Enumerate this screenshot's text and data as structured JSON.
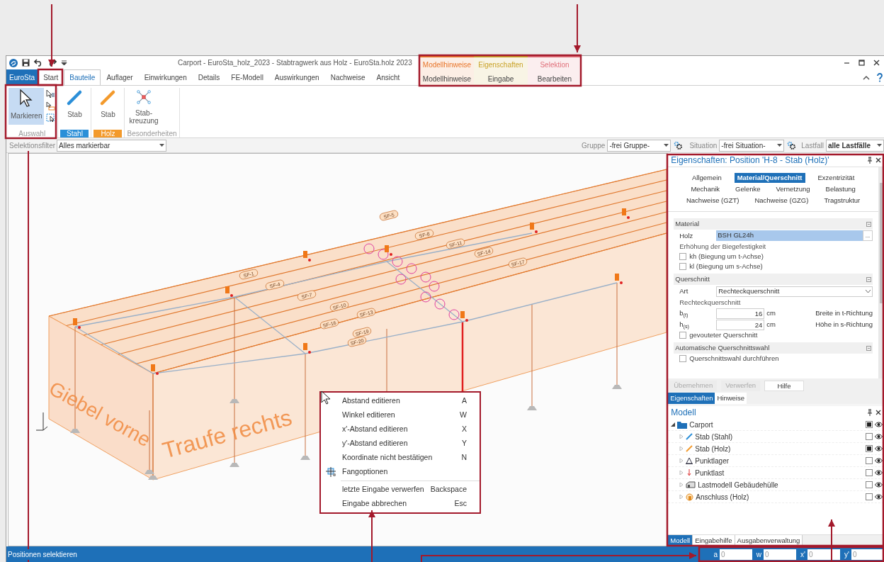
{
  "window": {
    "title": "Carport - EuroSta_holz_2023 - Stabtragwerk aus Holz - EuroSta.holz 2023"
  },
  "ribbon_tabs": [
    {
      "label": "EuroSta",
      "kind": "file",
      "selected": false
    },
    {
      "label": "Start",
      "kind": "tab",
      "selected": false
    },
    {
      "label": "Bauteile",
      "kind": "tab",
      "selected": true
    },
    {
      "label": "Auflager",
      "kind": "tab",
      "selected": false
    },
    {
      "label": "Einwirkungen",
      "kind": "tab",
      "selected": false
    },
    {
      "label": "Details",
      "kind": "tab",
      "selected": false
    },
    {
      "label": "FE-Modell",
      "kind": "tab",
      "selected": false
    },
    {
      "label": "Auswirkungen",
      "kind": "tab",
      "selected": false
    },
    {
      "label": "Nachweise",
      "kind": "tab",
      "selected": false
    },
    {
      "label": "Ansicht",
      "kind": "tab",
      "selected": false
    }
  ],
  "contextual_tabs": [
    {
      "group": "Modellhinweise",
      "label": "Modellhinweise",
      "color": "#e8752a"
    },
    {
      "group": "Eigenschaften",
      "label": "Eingabe",
      "color": "#c9a227"
    },
    {
      "group": "Selektion",
      "label": "Bearbeiten",
      "color": "#e0707a"
    }
  ],
  "ribbon_groups": [
    {
      "label": "Auswahl",
      "kind": "select",
      "buttons": [
        {
          "label": "Markieren",
          "selected": true
        }
      ]
    },
    {
      "label": "Stahl",
      "kind": "colored",
      "color": "#2b8fd8",
      "buttons": [
        {
          "label": "Stab",
          "selected": false
        }
      ]
    },
    {
      "label": "Holz",
      "kind": "colored",
      "color": "#f39a2c",
      "buttons": [
        {
          "label": "Stab",
          "selected": false
        }
      ]
    },
    {
      "label": "Besonderheiten",
      "kind": "plain",
      "buttons": [
        {
          "label": "Stab-\nkreuzung",
          "selected": false
        }
      ]
    }
  ],
  "filter_bar": {
    "selection_filter": {
      "label": "Selektionsfilter",
      "value": "Alles markierbar"
    },
    "group": {
      "label": "Gruppe",
      "value": "-frei Gruppe-"
    },
    "situation": {
      "label": "Situation",
      "value": "-frei Situation-"
    },
    "load_case": {
      "label": "Lastfall",
      "value": "alle Lastfälle"
    }
  },
  "viewport": {
    "gable_text": "Giebel vorne",
    "eaves_text": "Traufe rechts",
    "member_labels": [
      "SF-1",
      "SF-4",
      "SF-7",
      "SF-10",
      "SF-13",
      "SF-16",
      "SF-19",
      "SF-20",
      "SF-5",
      "SF-8",
      "SF-11",
      "SF-14",
      "SF-17"
    ]
  },
  "context_menu": {
    "items": [
      {
        "label": "Abstand editieren",
        "shortcut": "A",
        "kind": "plain",
        "separator_before": false
      },
      {
        "label": "Winkel editieren",
        "shortcut": "W",
        "kind": "plain",
        "separator_before": false
      },
      {
        "label": "x'-Abstand editieren",
        "shortcut": "X",
        "kind": "plain",
        "separator_before": false
      },
      {
        "label": "y'-Abstand editieren",
        "shortcut": "Y",
        "kind": "plain",
        "separator_before": false
      },
      {
        "label": "Koordinate nicht bestätigen",
        "shortcut": "N",
        "kind": "plain",
        "separator_before": false
      },
      {
        "label": "Fangoptionen",
        "kind": "snap",
        "separator_before": false
      },
      {
        "label": "letzte Eingabe verwerfen",
        "shortcut": "Backspace",
        "kind": "plain",
        "separator_before": true
      },
      {
        "label": "Eingabe abbrechen",
        "shortcut": "Esc",
        "kind": "plain",
        "separator_before": false
      }
    ]
  },
  "properties": {
    "title": "Eigenschaften: Position 'H-8 - Stab (Holz)'",
    "tabs": [
      {
        "label": "Allgemein",
        "selected": false
      },
      {
        "label": "Material/Querschnitt",
        "selected": true
      },
      {
        "label": "Exzentrizität",
        "selected": false
      },
      {
        "label": "Mechanik",
        "selected": false
      },
      {
        "label": "Gelenke",
        "selected": false
      },
      {
        "label": "Vernetzung",
        "selected": false
      },
      {
        "label": "Belastung",
        "selected": false
      },
      {
        "label": "Nachweise (GZT)",
        "selected": false
      },
      {
        "label": "Nachweise (GZG)",
        "selected": false
      },
      {
        "label": "Tragstruktur",
        "selected": false
      }
    ],
    "sections": [
      {
        "title": "Material",
        "rows": [
          {
            "kind": "field",
            "label": "Holz",
            "value": "BSH GL24h",
            "button": "...",
            "selected": true
          },
          {
            "kind": "caption",
            "label": "Erhöhung der Biegefestigkeit"
          },
          {
            "kind": "checkbox",
            "label": "kh (Biegung um t-Achse)",
            "checked": false
          },
          {
            "kind": "checkbox",
            "label": "kl (Biegung um s-Achse)",
            "checked": false
          }
        ]
      },
      {
        "title": "Querschnitt",
        "rows": [
          {
            "kind": "select",
            "label": "Art",
            "value": "Rechteckquerschnitt"
          },
          {
            "kind": "caption",
            "label": "Rechteckquerschnitt"
          },
          {
            "kind": "dimension",
            "label": "b$_{(t)}$",
            "value": "16",
            "unit": "cm",
            "description": "Breite in t-Richtung"
          },
          {
            "kind": "dimension",
            "label": "h$_{(s)}$",
            "value": "24",
            "unit": "cm",
            "description": "Höhe in s-Richtung"
          },
          {
            "kind": "checkbox",
            "label": "gevouteter Querschnitt",
            "checked": false
          }
        ]
      },
      {
        "title": "Automatische Querschnittswahl",
        "rows": [
          {
            "kind": "checkbox",
            "label": "Querschnittswahl durchführen",
            "checked": false
          }
        ]
      }
    ]
  },
  "actions": [
    {
      "label": "Übernehmen",
      "disabled": true
    },
    {
      "label": "Verwerfen",
      "disabled": true
    },
    {
      "label": "Hilfe",
      "disabled": false
    }
  ],
  "panel_tabs": [
    {
      "label": "Eigenschaften",
      "selected": true
    },
    {
      "label": "Hinweise",
      "selected": false
    }
  ],
  "model": {
    "title": "Modell",
    "tree": [
      {
        "label": "Carport",
        "kind": "folder",
        "expanded": true,
        "checked": true,
        "children": [
          {
            "label": "Stab (Stahl)",
            "kind": "steel",
            "expanded": false,
            "checked": false
          },
          {
            "label": "Stab (Holz)",
            "kind": "timber",
            "expanded": false,
            "checked": true
          },
          {
            "label": "Punktlager",
            "kind": "support",
            "expanded": false,
            "checked": false
          },
          {
            "label": "Punktlast",
            "kind": "load",
            "expanded": false,
            "checked": false
          },
          {
            "label": "Lastmodell Gebäudehülle",
            "kind": "building",
            "expanded": false,
            "checked": false
          },
          {
            "label": "Anschluss (Holz)",
            "kind": "joint",
            "expanded": false,
            "checked": false
          }
        ]
      }
    ]
  },
  "bottom_tabs": [
    {
      "label": "Modell",
      "selected": true
    },
    {
      "label": "Eingabehilfe",
      "selected": false
    },
    {
      "label": "Ausgabenverwaltung",
      "selected": false
    }
  ],
  "status_bar": {
    "text": "Positionen selektieren",
    "inputs": [
      {
        "label": "a",
        "placeholder": "0"
      },
      {
        "label": "w",
        "placeholder": "0"
      },
      {
        "label": "x'",
        "placeholder": "0"
      },
      {
        "label": "y'",
        "placeholder": "0"
      }
    ]
  }
}
